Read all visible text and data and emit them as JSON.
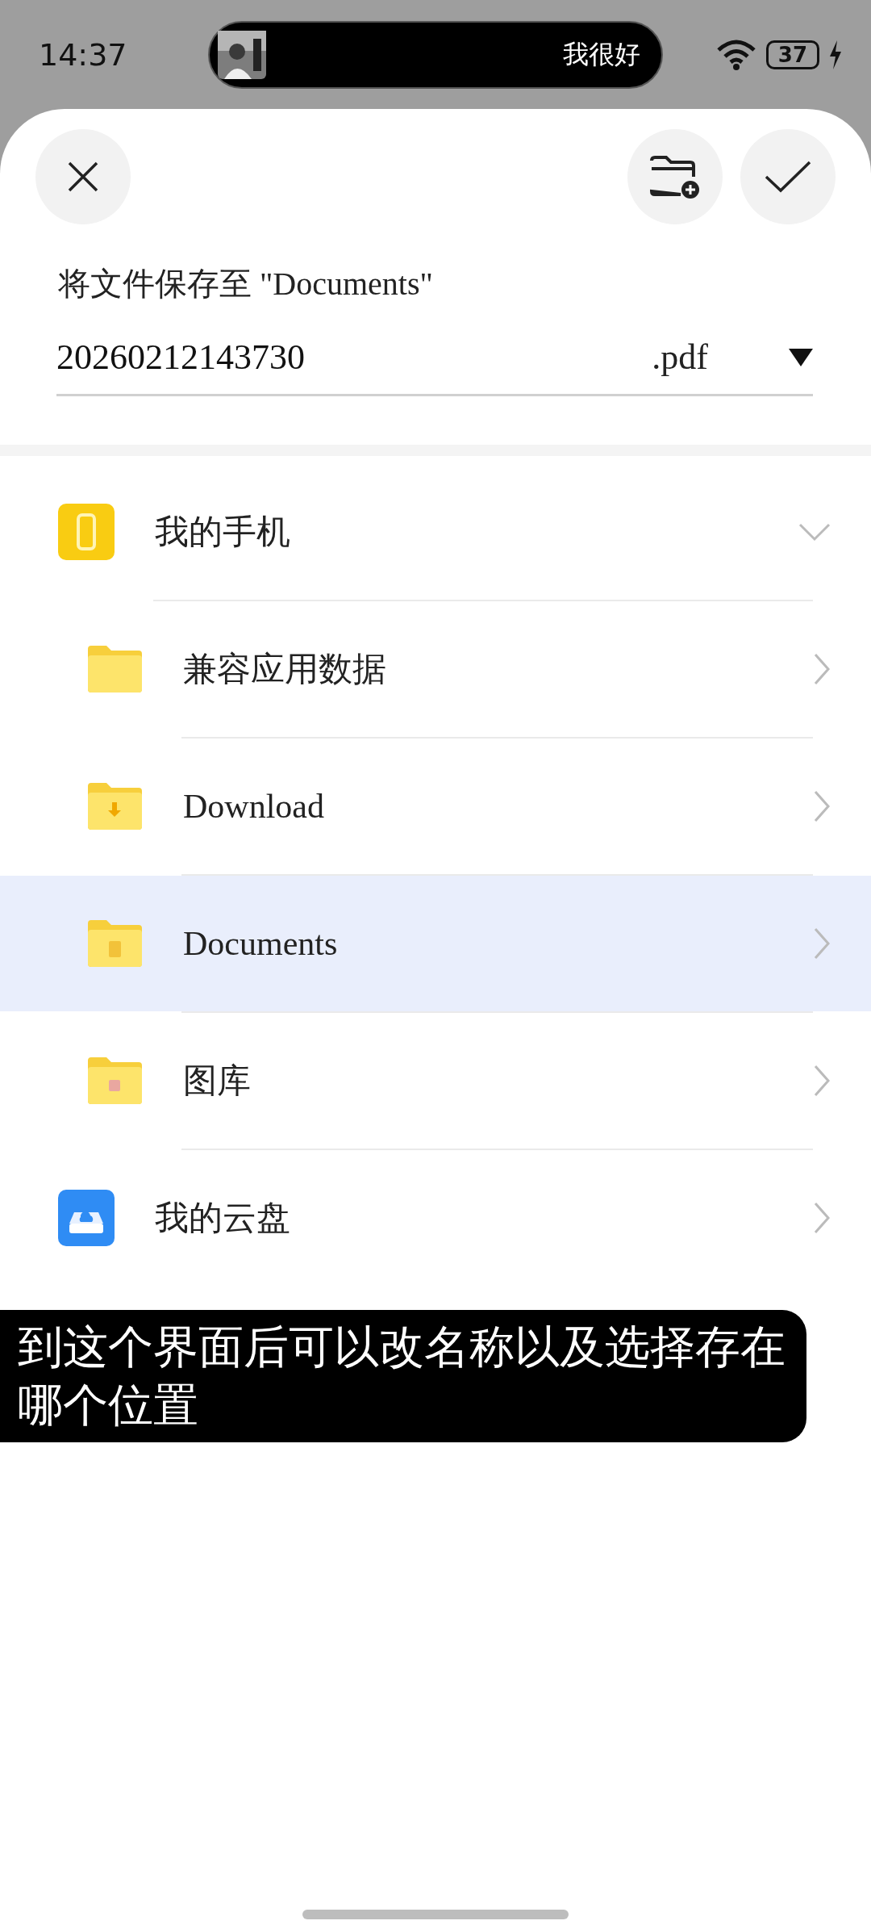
{
  "status_bar": {
    "time": "14:37",
    "now_playing": {
      "title": "我很好"
    },
    "battery": "37"
  },
  "sheet": {
    "title": "将文件保存至 \"Documents\"",
    "file_name": {
      "value": "20260212143730"
    },
    "extension": ".pdf",
    "locations": [
      {
        "label": "我的手机",
        "kind": "phone",
        "expanded": true,
        "selected": false,
        "children": [
          {
            "label": "兼容应用数据",
            "kind": "folder",
            "selected": false
          },
          {
            "label": "Download",
            "kind": "download",
            "selected": false
          },
          {
            "label": "Documents",
            "kind": "documents",
            "selected": true
          },
          {
            "label": "图库",
            "kind": "gallery",
            "selected": false
          }
        ]
      },
      {
        "label": "我的云盘",
        "kind": "cloud",
        "expanded": false,
        "selected": false
      }
    ]
  },
  "caption": "到这个界面后可以改名称以及选择存在哪个位置"
}
